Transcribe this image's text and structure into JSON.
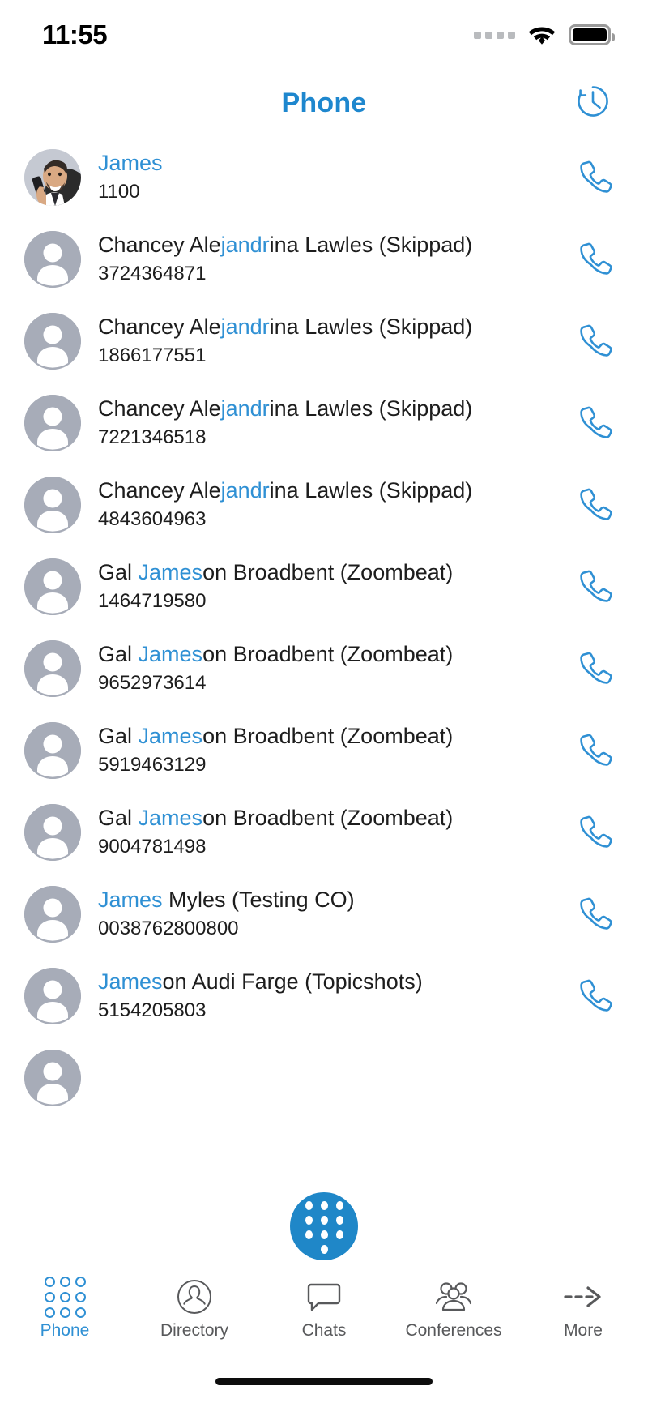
{
  "status_bar": {
    "time": "11:55",
    "signal_icon": "signal-dots-icon",
    "wifi_icon": "wifi-icon",
    "battery_icon": "battery-full-icon"
  },
  "header": {
    "title": "Phone",
    "history_icon": "call-history-clock-icon",
    "accent_color": "#1e87ce"
  },
  "colors": {
    "accent": "#2f90d4",
    "title": "#1e87ce",
    "fab": "#1f87c8",
    "avatar_bg": "#a7acb8",
    "text": "#1d1d1d",
    "tab_inactive": "#58595b"
  },
  "contacts": [
    {
      "name_before": "",
      "name_match": "James",
      "name_after": "",
      "number": "1100",
      "avatar": "photo-avatar-man-on-phone",
      "call_icon": "phone-handset-icon"
    },
    {
      "name_before": "Chancey Ale",
      "name_match": "jandr",
      "name_after": "ina Lawles (Skippad)",
      "number": "3724364871",
      "avatar": "default-person-avatar",
      "call_icon": "phone-handset-icon"
    },
    {
      "name_before": "Chancey Ale",
      "name_match": "jandr",
      "name_after": "ina Lawles (Skippad)",
      "number": "1866177551",
      "avatar": "default-person-avatar",
      "call_icon": "phone-handset-icon"
    },
    {
      "name_before": "Chancey Ale",
      "name_match": "jandr",
      "name_after": "ina Lawles (Skippad)",
      "number": "7221346518",
      "avatar": "default-person-avatar",
      "call_icon": "phone-handset-icon"
    },
    {
      "name_before": "Chancey Ale",
      "name_match": "jandr",
      "name_after": "ina Lawles (Skippad)",
      "number": "4843604963",
      "avatar": "default-person-avatar",
      "call_icon": "phone-handset-icon"
    },
    {
      "name_before": "Gal ",
      "name_match": "James",
      "name_after": "on Broadbent (Zoombeat)",
      "number": "1464719580",
      "avatar": "default-person-avatar",
      "call_icon": "phone-handset-icon"
    },
    {
      "name_before": "Gal ",
      "name_match": "James",
      "name_after": "on Broadbent (Zoombeat)",
      "number": "9652973614",
      "avatar": "default-person-avatar",
      "call_icon": "phone-handset-icon"
    },
    {
      "name_before": "Gal ",
      "name_match": "James",
      "name_after": "on Broadbent (Zoombeat)",
      "number": "5919463129",
      "avatar": "default-person-avatar",
      "call_icon": "phone-handset-icon"
    },
    {
      "name_before": "Gal ",
      "name_match": "James",
      "name_after": "on Broadbent (Zoombeat)",
      "number": "9004781498",
      "avatar": "default-person-avatar",
      "call_icon": "phone-handset-icon"
    },
    {
      "name_before": "",
      "name_match": "James",
      "name_after": "  Myles (Testing CO)",
      "number": "0038762800800",
      "avatar": "default-person-avatar",
      "call_icon": "phone-handset-icon"
    },
    {
      "name_before": "",
      "name_match": "James",
      "name_after": "on Audi Farge (Topicshots)",
      "number": "5154205803",
      "avatar": "default-person-avatar",
      "call_icon": "phone-handset-icon"
    },
    {
      "name_before": "",
      "name_match": "",
      "name_after": "",
      "number": "",
      "avatar": "default-person-avatar",
      "call_icon": "phone-handset-icon"
    }
  ],
  "dial_fab": {
    "icon": "dialpad-icon",
    "label": "Dialpad"
  },
  "tab_bar": {
    "items": [
      {
        "label": "Phone",
        "icon": "dialpad-grid-icon",
        "active": true
      },
      {
        "label": "Directory",
        "icon": "person-circle-icon",
        "active": false
      },
      {
        "label": "Chats",
        "icon": "chat-bubble-icon",
        "active": false
      },
      {
        "label": "Conferences",
        "icon": "group-people-icon",
        "active": false
      },
      {
        "label": "More",
        "icon": "dashed-arrow-icon",
        "active": false
      }
    ]
  },
  "home_indicator": "home-indicator-bar"
}
